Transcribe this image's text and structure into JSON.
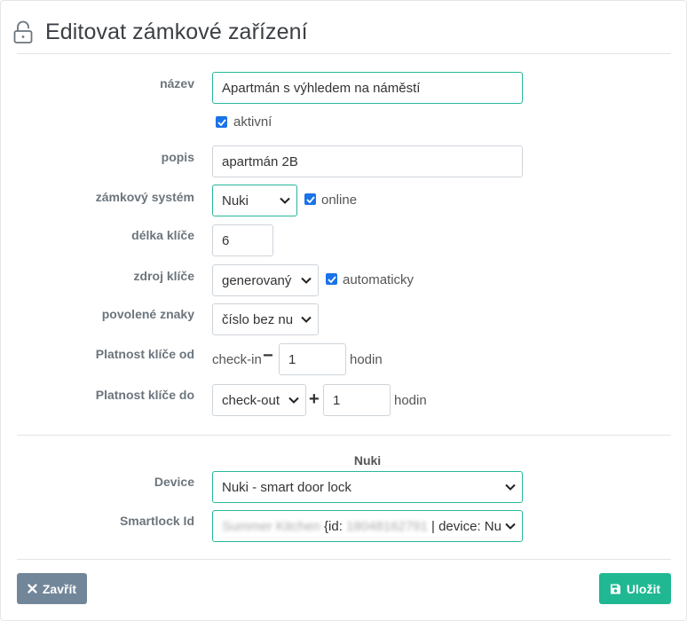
{
  "header": {
    "title": "Editovat zámkové zařízení",
    "icon": "unlock-icon"
  },
  "form": {
    "name": {
      "label": "název",
      "value": "Apartmán s výhledem na náměstí"
    },
    "active": {
      "label": "aktivní",
      "checked": true
    },
    "description": {
      "label": "popis",
      "value": "apartmán 2B"
    },
    "lock_system": {
      "label": "zámkový systém",
      "value": "Nuki",
      "online_label": "online",
      "online_checked": true
    },
    "key_length": {
      "label": "délka klíče",
      "value": "6"
    },
    "key_source": {
      "label": "zdroj klíče",
      "value": "generovaný",
      "auto_label": "automaticky",
      "auto_checked": true
    },
    "allowed_chars": {
      "label": "povolené znaky",
      "value": "číslo bez nu"
    },
    "valid_from": {
      "label": "Platnost klíče od",
      "prefix": "check-in",
      "sign": "−",
      "hours": "1",
      "unit": "hodin"
    },
    "valid_to": {
      "label": "Platnost klíče do",
      "value": "check-out",
      "sign": "+",
      "hours": "1",
      "unit": "hodin"
    }
  },
  "nuki": {
    "section_title": "Nuki",
    "device": {
      "label": "Device",
      "value": "Nuki - smart door lock"
    },
    "smartlock": {
      "label": "Smartlock Id",
      "blurred_name": "Summer Kitchen",
      "id_prefix": "{id:",
      "blurred_id": "18048162791",
      "device_suffix": "| device: Nu"
    }
  },
  "footer": {
    "close_label": "Zavřít",
    "save_label": "Uložit"
  },
  "colors": {
    "accent": "#26b89a",
    "save": "#1fb892",
    "close": "#72869a",
    "checkbox": "#1a73e8"
  }
}
